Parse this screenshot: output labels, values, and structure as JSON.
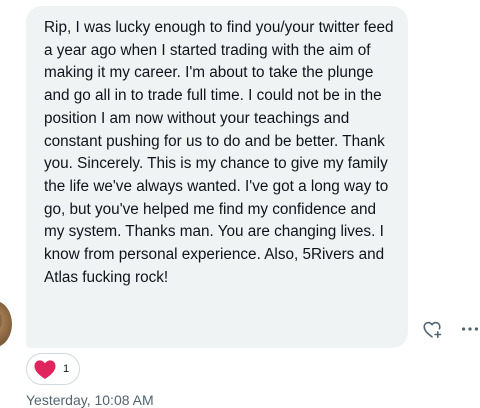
{
  "message": {
    "text": "Rip, I was lucky enough to find you/your twitter feed a year ago when I started trading with the aim of making it my career. I'm about to take the plunge and go all in to trade full time. I could not be in the position I am now without your teachings and constant pushing for us to do and be better. Thank you. Sincerely. This is my chance to give my family the life we've always wanted. I've got a long way to go, but you've helped me find my confidence and my system. Thanks man. You are changing lives. I know from personal experience. Also, 5Rivers and Atlas fucking rock!",
    "timestamp": "Yesterday, 10:08 AM"
  },
  "reaction": {
    "icon": "heart-icon",
    "count": "1",
    "color": "#e0245e"
  },
  "actions": {
    "react_icon": "heart-plus-icon",
    "more_icon": "more-horizontal-icon"
  },
  "colors": {
    "bubble_background": "#eff3f4",
    "text": "#0f1419",
    "muted_text": "#536471",
    "border": "#cfd9de"
  }
}
